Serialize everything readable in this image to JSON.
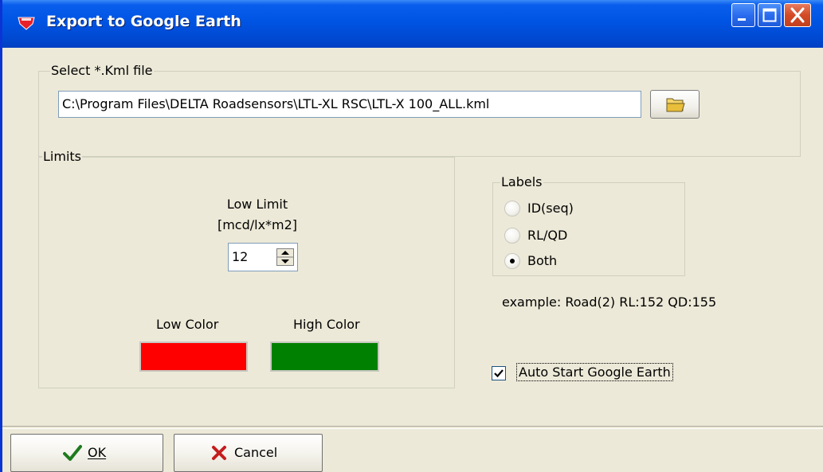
{
  "window": {
    "title": "Export to Google Earth",
    "titlebar_color": "#0054E3"
  },
  "file_group": {
    "title": "Select *.Kml file",
    "path_value": "C:\\Program Files\\DELTA Roadsensors\\LTL-XL RSC\\LTL-X 100_ALL.kml",
    "browse_icon": "folder-icon"
  },
  "limits": {
    "title": "Limits",
    "low_limit_label": "Low Limit\n[mcd/lx*m2]",
    "low_limit_value": "12",
    "low_color_label": "Low Color",
    "high_color_label": "High Color",
    "low_color": "#FF0000",
    "high_color": "#008000"
  },
  "labels": {
    "title": "Labels",
    "options": [
      "ID(seq)",
      "RL/QD",
      "Both"
    ],
    "selected": "Both",
    "example": "example: Road(2) RL:152 QD:155"
  },
  "auto_start": {
    "label": "Auto Start Google Earth",
    "checked": true
  },
  "buttons": {
    "ok": "OK",
    "cancel": "Cancel"
  }
}
